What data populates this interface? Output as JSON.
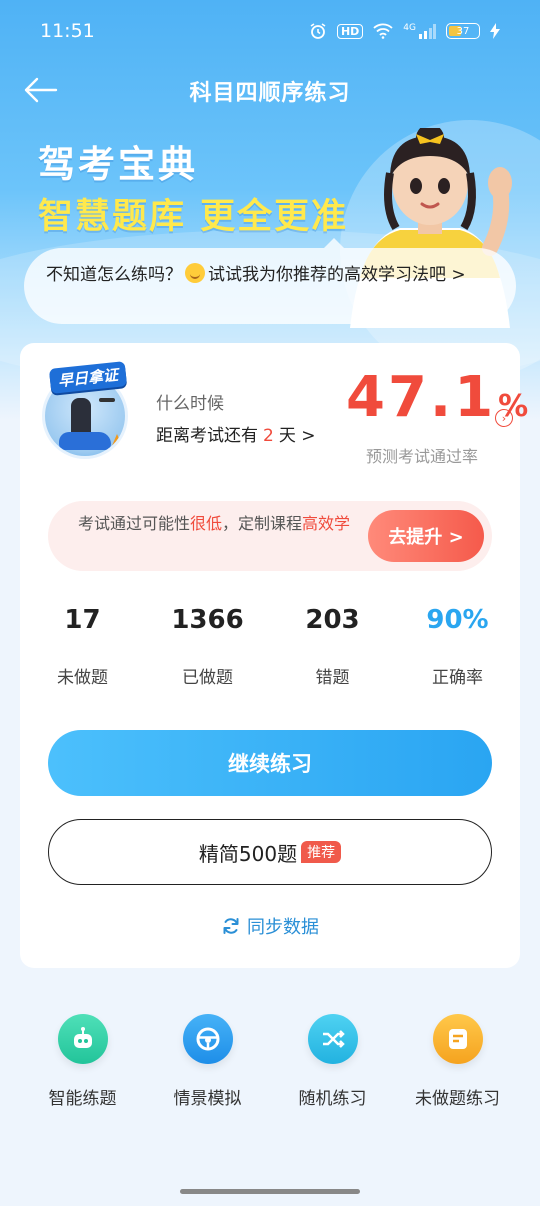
{
  "status_bar": {
    "time": "11:51",
    "network": "4G",
    "hd": "HD",
    "battery": "37"
  },
  "nav": {
    "title": "科目四顺序练习"
  },
  "banner": {
    "title_line1": "驾考宝典",
    "title_line2": "智慧题库 更全更准",
    "tip_before_emoji": "不知道怎么练吗？",
    "tip_after_emoji": "试试我为你推荐的高效学习法吧 >"
  },
  "exam": {
    "badge_text": "早日拿证",
    "when_label": "什么时候",
    "countdown_prefix": "距离考试还有",
    "countdown_days": "2",
    "countdown_suffix": "天 >",
    "pass_rate_value": "47.1",
    "pass_rate_unit": "%",
    "pass_rate_label": "预测考试通过率"
  },
  "advice": {
    "text_part1": "考试通过可能性",
    "text_highlight1": "很低",
    "text_part2": "，定制课程",
    "text_highlight2": "高效学",
    "button_label": "去提升 >"
  },
  "stats": [
    {
      "value": "17",
      "label": "未做题"
    },
    {
      "value": "1366",
      "label": "已做题"
    },
    {
      "value": "203",
      "label": "错题"
    },
    {
      "value": "90%",
      "label": "正确率"
    }
  ],
  "buttons": {
    "continue_label": "继续练习",
    "select_label": "精简500题",
    "select_tag": "推荐",
    "sync_label": "同步数据"
  },
  "actions": [
    {
      "label": "智能练题",
      "icon": "robot-icon",
      "color": "#2ecfa6"
    },
    {
      "label": "情景模拟",
      "icon": "steering-wheel-icon",
      "color": "#2a9cf2"
    },
    {
      "label": "随机练习",
      "icon": "shuffle-icon",
      "color": "#30c0e6"
    },
    {
      "label": "未做题练习",
      "icon": "document-icon",
      "color": "#f7b431"
    }
  ],
  "colors": {
    "accent_blue": "#2aa6f0",
    "danger_red": "#f04b3c",
    "banner_yellow": "#ffe94d"
  }
}
